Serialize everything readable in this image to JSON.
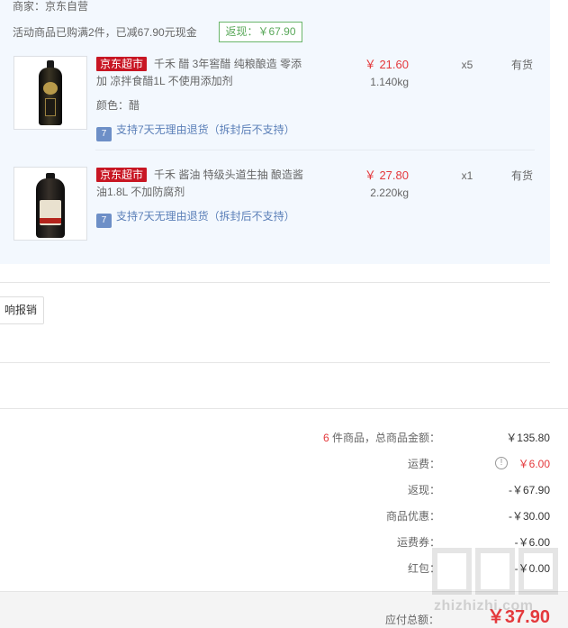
{
  "order": {
    "seller": "商家：京东自营",
    "promo_text": "活动商品已购满2件，已减67.90元现金",
    "rebate_tag": "返现：￥67.90",
    "items": [
      {
        "tag": "京东超市",
        "title": "千禾 醋 3年窖醋 纯粮酿造 零添加 凉拌食醋1L 不使用添加剂",
        "color": "颜色：醋",
        "return_policy": "支持7天无理由退货（拆封后不支持）",
        "price": "￥ 21.60",
        "weight": "1.140kg",
        "qty": "x5",
        "stock": "有货"
      },
      {
        "tag": "京东超市",
        "title": "千禾 酱油 特级头道生抽 酿造酱油1.8L 不加防腐剂",
        "return_policy": "支持7天无理由退货（拆封后不支持）",
        "price": "￥ 27.80",
        "weight": "2.220kg",
        "qty": "x1",
        "stock": "有货"
      }
    ],
    "return_icon_glyph": "7"
  },
  "invoice": {
    "button_label": "响报销"
  },
  "summary": {
    "count": "6",
    "goods_total_label": "件商品，总商品金额：",
    "goods_total_value": "￥135.80",
    "shipping_label": "运费：",
    "shipping_info_glyph": "!",
    "shipping_value": "￥6.00",
    "rebate_label": "返现：",
    "rebate_value": "-￥67.90",
    "discount_label": "商品优惠：",
    "discount_value": "-￥30.00",
    "shipping_coupon_label": "运费券：",
    "shipping_coupon_value": "-￥6.00",
    "red_packet_label": "红包：",
    "red_packet_value": "-￥0.00"
  },
  "total": {
    "label": "应付总额：",
    "value": "￥37.90"
  },
  "watermark": {
    "text": "zhizhizhi.com"
  },
  "colors": {
    "panel_bg": "#f3f8fe",
    "price_red": "#e4393c",
    "jd_red": "#c81623",
    "rebate_green": "#5aa85a",
    "link_blue": "#5b7fb8"
  }
}
